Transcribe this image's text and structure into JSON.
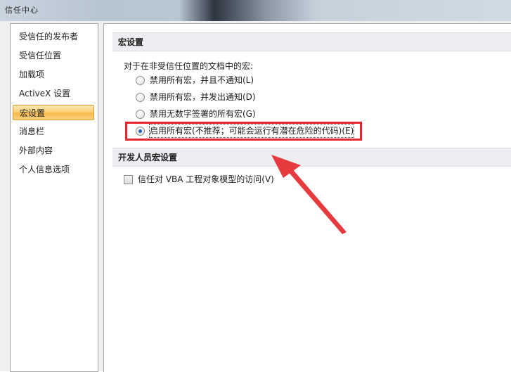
{
  "window": {
    "title": "信任中心"
  },
  "sidebar": {
    "items": [
      {
        "label": "受信任的发布者"
      },
      {
        "label": "受信任位置"
      },
      {
        "label": "加载项"
      },
      {
        "label": "ActiveX 设置"
      },
      {
        "label": "宏设置",
        "selected": true
      },
      {
        "label": "消息栏"
      },
      {
        "label": "外部内容"
      },
      {
        "label": "个人信息选项"
      }
    ]
  },
  "macro_settings": {
    "header": "宏设置",
    "description": "对于在非受信任位置的文档中的宏:",
    "options": [
      {
        "label": "禁用所有宏，并且不通知(L)",
        "checked": false
      },
      {
        "label": "禁用所有宏，并发出通知(D)",
        "checked": false
      },
      {
        "label": "禁用无数字签署的所有宏(G)",
        "checked": false
      },
      {
        "label": "启用所有宏(不推荐；可能会运行有潜在危险的代码)(E)",
        "checked": true
      }
    ]
  },
  "developer_settings": {
    "header": "开发人员宏设置",
    "vba_access_label": "信任对 VBA 工程对象模型的访问(V)",
    "vba_access_checked": false
  },
  "colors": {
    "annotation": "#e5262c",
    "selection": "#f7b84a"
  }
}
